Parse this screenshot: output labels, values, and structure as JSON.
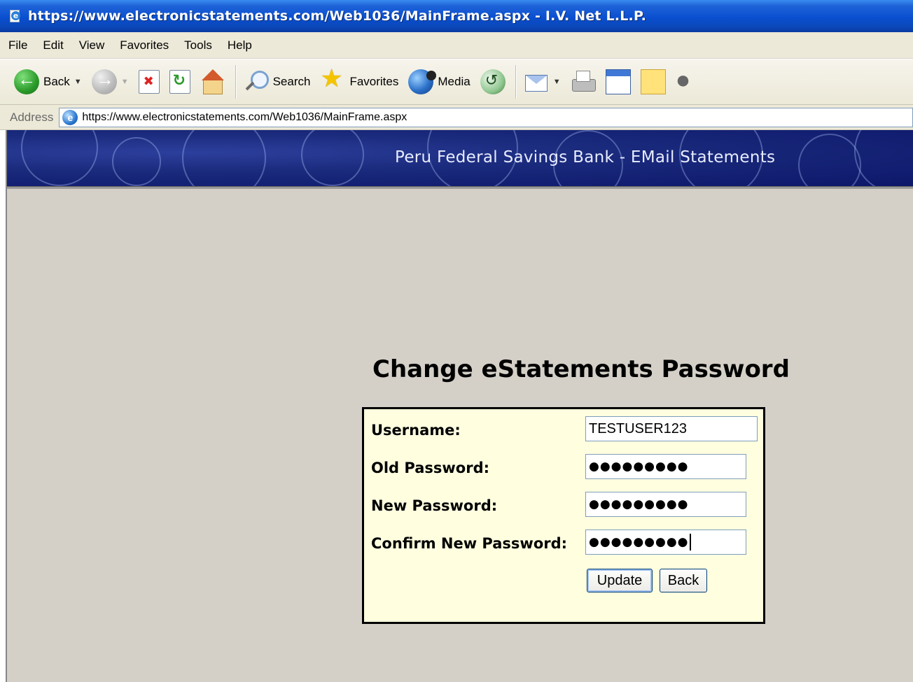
{
  "window": {
    "title": "https://www.electronicstatements.com/Web1036/MainFrame.aspx - I.V. Net L.L.P."
  },
  "menu": {
    "items": [
      "File",
      "Edit",
      "View",
      "Favorites",
      "Tools",
      "Help"
    ]
  },
  "toolbar": {
    "back_label": "Back",
    "search_label": "Search",
    "favorites_label": "Favorites",
    "media_label": "Media"
  },
  "address": {
    "label": "Address",
    "url": "https://www.electronicstatements.com/Web1036/MainFrame.aspx"
  },
  "banner": {
    "title": "Peru Federal Savings Bank - EMail Statements"
  },
  "form": {
    "title": "Change eStatements Password",
    "username_label": "Username:",
    "username_value": "TESTUSER123",
    "old_password_label": "Old Password:",
    "old_password_value": "●●●●●●●●●",
    "new_password_label": "New Password:",
    "new_password_value": "●●●●●●●●●",
    "confirm_password_label": "Confirm New Password:",
    "confirm_password_value": "●●●●●●●●●",
    "update_button": "Update",
    "back_button": "Back"
  },
  "colors": {
    "titlebar": "#0a4fd0",
    "banner": "#1a2a7c",
    "form_background": "#ffffe0",
    "page_background": "#d4d0c8"
  }
}
